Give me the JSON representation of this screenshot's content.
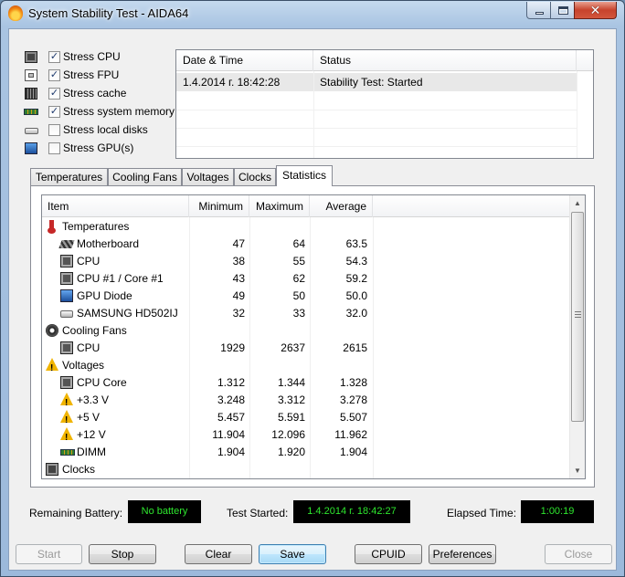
{
  "window": {
    "title": "System Stability Test - AIDA64"
  },
  "stress_options": [
    {
      "icon": "cpu-chip-icon",
      "label": "Stress CPU",
      "checked": true
    },
    {
      "icon": "fpu-chip-icon",
      "label": "Stress FPU",
      "checked": true
    },
    {
      "icon": "cache-chip-icon",
      "label": "Stress cache",
      "checked": true
    },
    {
      "icon": "memory-module-icon",
      "label": "Stress system memory",
      "checked": true
    },
    {
      "icon": "hard-disk-icon",
      "label": "Stress local disks",
      "checked": false
    },
    {
      "icon": "gpu-monitor-icon",
      "label": "Stress GPU(s)",
      "checked": false
    }
  ],
  "status_list": {
    "columns": [
      "Date & Time",
      "Status"
    ],
    "rows": [
      {
        "datetime": "1.4.2014 г. 18:42:28",
        "status": "Stability Test: Started"
      }
    ]
  },
  "tabs": [
    {
      "label": "Temperatures",
      "active": false
    },
    {
      "label": "Cooling Fans",
      "active": false
    },
    {
      "label": "Voltages",
      "active": false
    },
    {
      "label": "Clocks",
      "active": false
    },
    {
      "label": "Statistics",
      "active": true
    }
  ],
  "statistics": {
    "columns": {
      "item": "Item",
      "min": "Minimum",
      "max": "Maximum",
      "avg": "Average"
    },
    "rows": [
      {
        "group": true,
        "icon": "thermometer-icon",
        "name": "Temperatures",
        "min": "",
        "max": "",
        "avg": ""
      },
      {
        "group": false,
        "icon": "motherboard-icon",
        "name": "Motherboard",
        "min": "47",
        "max": "64",
        "avg": "63.5"
      },
      {
        "group": false,
        "icon": "cpu-icon",
        "name": "CPU",
        "min": "38",
        "max": "55",
        "avg": "54.3"
      },
      {
        "group": false,
        "icon": "cpu-icon",
        "name": "CPU #1 / Core #1",
        "min": "43",
        "max": "62",
        "avg": "59.2"
      },
      {
        "group": false,
        "icon": "gpu-icon",
        "name": "GPU Diode",
        "min": "49",
        "max": "50",
        "avg": "50.0"
      },
      {
        "group": false,
        "icon": "hard-disk-icon",
        "name": "SAMSUNG HD502IJ",
        "min": "32",
        "max": "33",
        "avg": "32.0"
      },
      {
        "group": true,
        "icon": "fan-icon",
        "name": "Cooling Fans",
        "min": "",
        "max": "",
        "avg": ""
      },
      {
        "group": false,
        "icon": "cpu-icon",
        "name": "CPU",
        "min": "1929",
        "max": "2637",
        "avg": "2615"
      },
      {
        "group": true,
        "icon": "warning-icon",
        "name": "Voltages",
        "min": "",
        "max": "",
        "avg": ""
      },
      {
        "group": false,
        "icon": "cpu-icon",
        "name": "CPU Core",
        "min": "1.312",
        "max": "1.344",
        "avg": "1.328"
      },
      {
        "group": false,
        "icon": "warning-icon",
        "name": "+3.3 V",
        "min": "3.248",
        "max": "3.312",
        "avg": "3.278"
      },
      {
        "group": false,
        "icon": "warning-icon",
        "name": "+5 V",
        "min": "5.457",
        "max": "5.591",
        "avg": "5.507"
      },
      {
        "group": false,
        "icon": "warning-icon",
        "name": "+12 V",
        "min": "11.904",
        "max": "12.096",
        "avg": "11.962"
      },
      {
        "group": false,
        "icon": "memory-module-icon",
        "name": "DIMM",
        "min": "1.904",
        "max": "1.920",
        "avg": "1.904"
      },
      {
        "group": true,
        "icon": "clock-chip-icon",
        "name": "Clocks",
        "min": "",
        "max": "",
        "avg": ""
      }
    ]
  },
  "info_bar": {
    "battery_label": "Remaining Battery:",
    "battery_value": "No battery",
    "started_label": "Test Started:",
    "started_value": "1.4.2014 г. 18:42:27",
    "elapsed_label": "Elapsed Time:",
    "elapsed_value": "1:00:19"
  },
  "buttons": {
    "start": "Start",
    "stop": "Stop",
    "clear": "Clear",
    "save": "Save",
    "cpuid": "CPUID",
    "preferences": "Preferences",
    "close": "Close"
  },
  "colors": {
    "lcd_text": "#2ee62e",
    "lcd_bg": "#000000"
  }
}
